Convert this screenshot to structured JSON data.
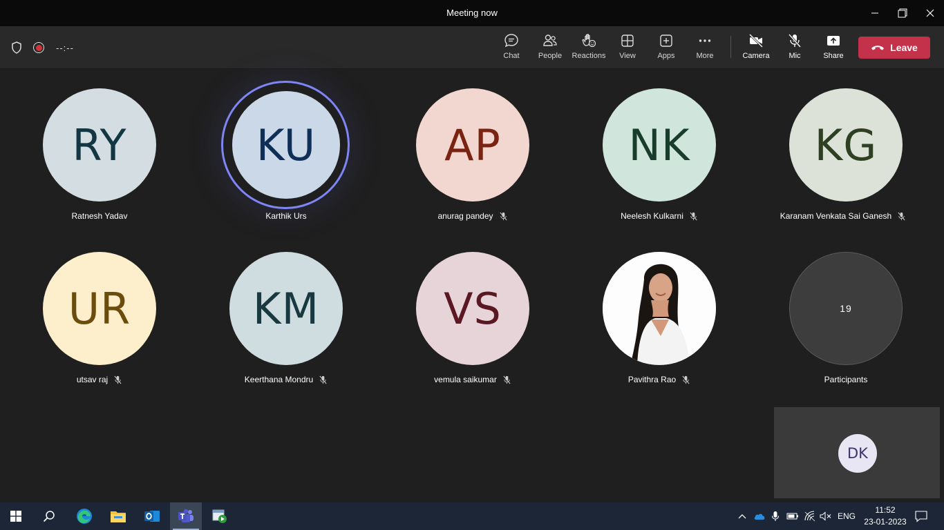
{
  "window": {
    "title": "Meeting now"
  },
  "toolbar": {
    "timer": "--:--",
    "buttons": {
      "chat": "Chat",
      "people": "People",
      "reactions": "Reactions",
      "view": "View",
      "apps": "Apps",
      "more": "More",
      "camera": "Camera",
      "mic": "Mic",
      "share": "Share"
    },
    "leave": "Leave",
    "leave_color": "#c4314b"
  },
  "participants": [
    {
      "initials": "RY",
      "name": "Ratnesh Yadav",
      "muted": false,
      "bg": "#d3dde2",
      "fg": "#123642"
    },
    {
      "initials": "KU",
      "name": "Karthik Urs",
      "muted": false,
      "bg": "#cad8e8",
      "fg": "#102f58",
      "speaking": true
    },
    {
      "initials": "AP",
      "name": "anurag pandey",
      "muted": true,
      "bg": "#f2d7d0",
      "fg": "#7b2311"
    },
    {
      "initials": "NK",
      "name": "Neelesh Kulkarni",
      "muted": true,
      "bg": "#d0e5dc",
      "fg": "#183d2a"
    },
    {
      "initials": "KG",
      "name": "Karanam Venkata Sai Ganesh",
      "muted": true,
      "bg": "#dde2d9",
      "fg": "#2e3f22"
    },
    {
      "initials": "UR",
      "name": "utsav raj",
      "muted": true,
      "bg": "#fdeecc",
      "fg": "#6c4c0c"
    },
    {
      "initials": "KM",
      "name": "Keerthana Mondru",
      "muted": true,
      "bg": "#cfdce0",
      "fg": "#17393f"
    },
    {
      "initials": "VS",
      "name": "vemula saikumar",
      "muted": true,
      "bg": "#e6d4d8",
      "fg": "#5a1822"
    },
    {
      "initials": "",
      "name": "Pavithra Rao",
      "muted": true,
      "photo": true
    },
    {
      "initials": "19",
      "name": "Participants",
      "muted": false,
      "overflow": true
    }
  ],
  "self_view": {
    "initials": "DK"
  },
  "taskbar": {
    "apps": [
      "start-icon",
      "search-icon",
      "edge-icon",
      "file-explorer-icon",
      "outlook-icon",
      "teams-icon",
      "media-app-icon"
    ],
    "lang": "ENG",
    "time": "11:52",
    "date": "23-01-2023"
  }
}
